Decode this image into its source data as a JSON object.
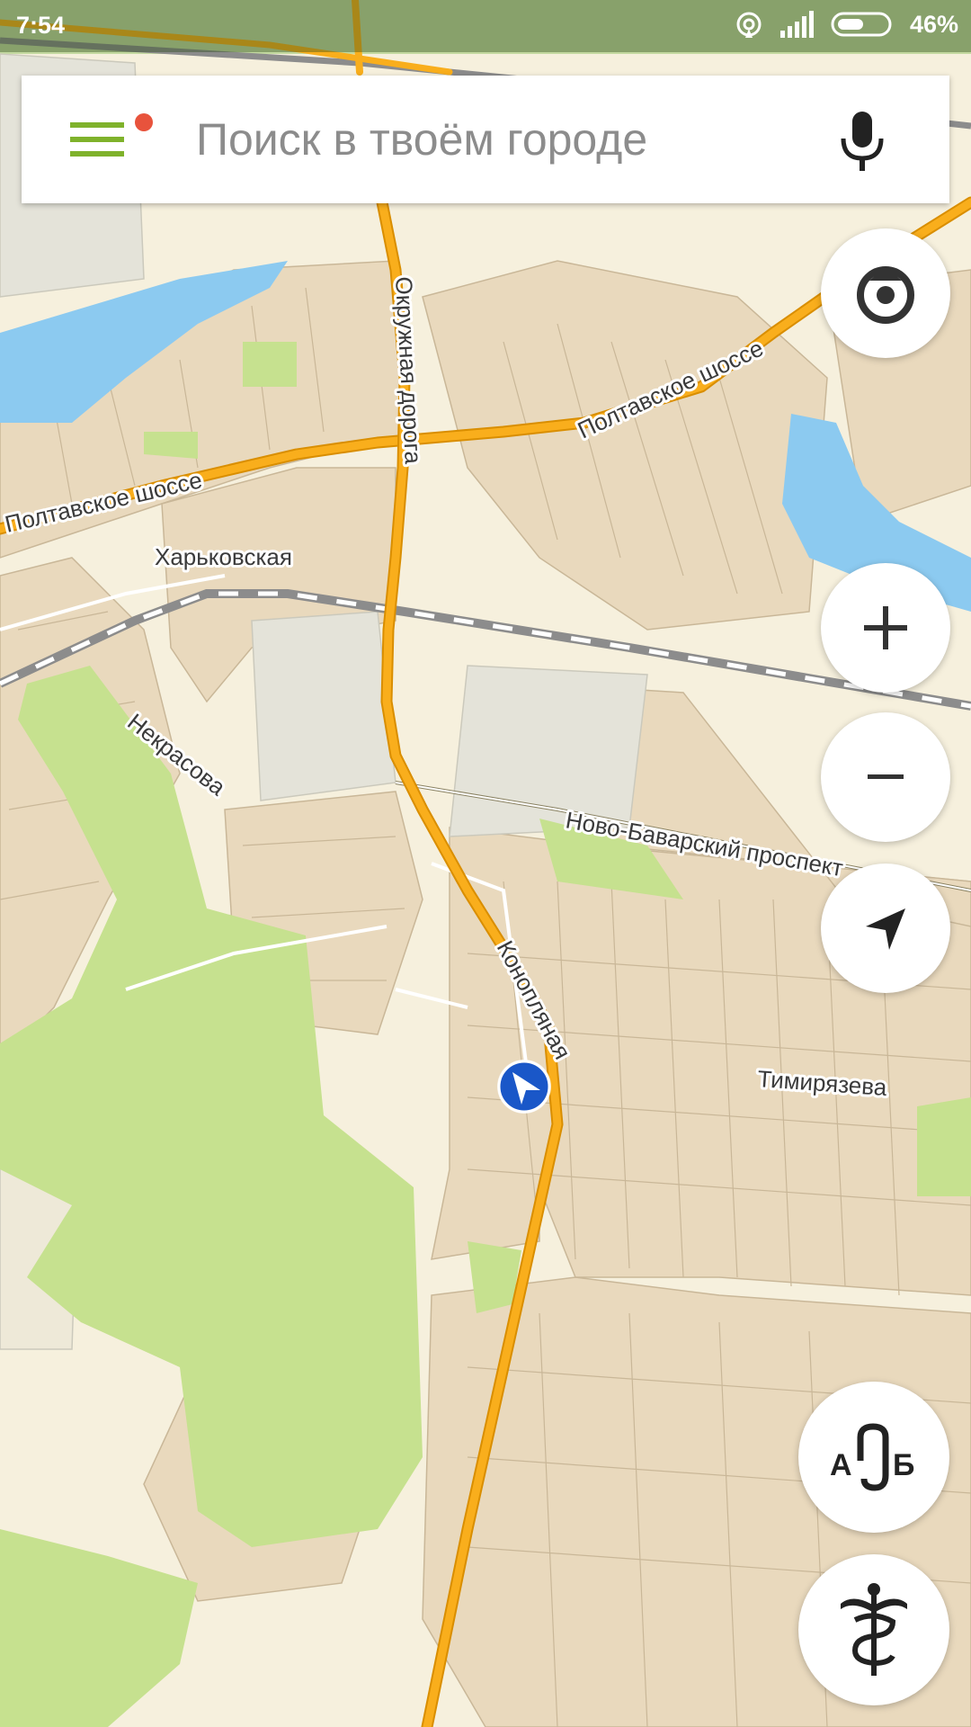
{
  "status_bar": {
    "time": "7:54",
    "battery": "46%"
  },
  "search": {
    "placeholder": "Поиск в твоём городе"
  },
  "map": {
    "streets": {
      "poltavskoe_west": "Полтавское шоссе",
      "poltavskoe_east": "Полтавское шоссе",
      "okruzhnaya": "Окружная дорога",
      "kharkovskaya": "Харьковская",
      "nekrasova": "Некрасова",
      "novo_bavarsky": "Ново-Баварский проспект",
      "konoplyanaya": "Конопляная",
      "timiryazeva": "Тимирязева"
    }
  },
  "route_button": {
    "letter_a": "А",
    "letter_b": "Б"
  },
  "colors": {
    "land": "#f6f0dd",
    "residential": "#e9d9bd",
    "park": "#c6e18f",
    "water": "#8ccaf0",
    "road_major": "#f9ae1c",
    "location": "#1a57c8",
    "notification_dot": "#e8533c"
  },
  "icons": {
    "menu": "hamburger-menu-icon",
    "mic": "microphone-icon",
    "compass": "compass-icon",
    "zoom_in": "plus-icon",
    "zoom_out": "minus-icon",
    "locate": "navigation-arrow-icon",
    "route": "route-ab-icon",
    "pharmacy": "caduceus-icon"
  }
}
